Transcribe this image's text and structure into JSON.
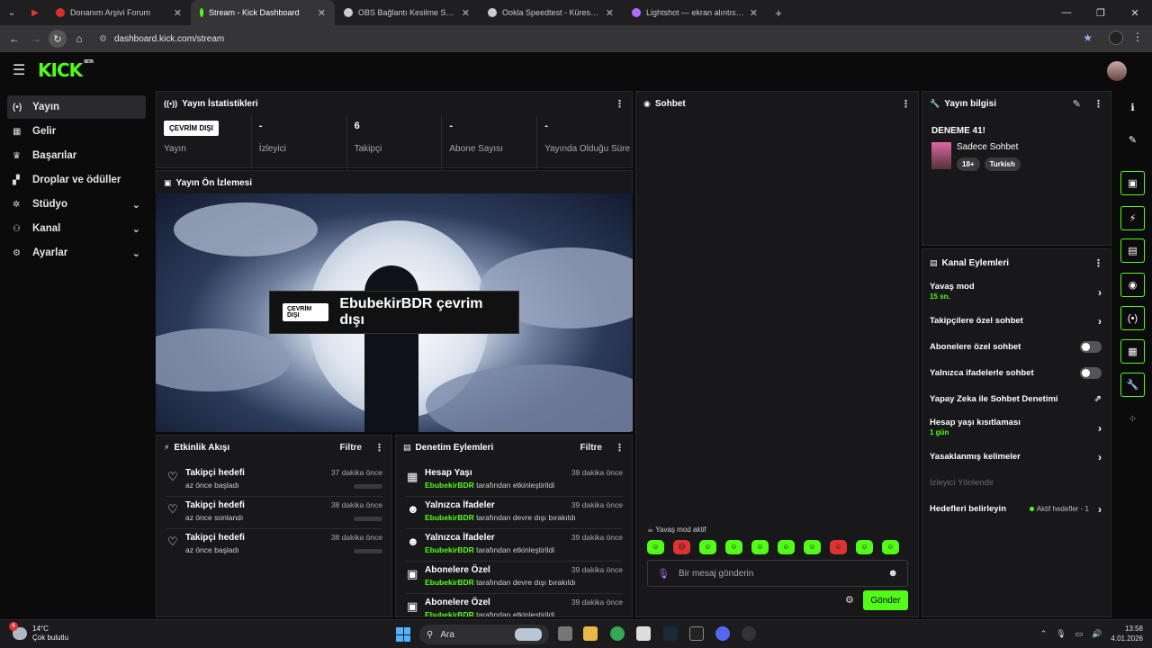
{
  "browser": {
    "tabs": [
      {
        "title": "Donanım Arşivi Forum",
        "color": "#d9302c"
      },
      {
        "title": "Stream - Kick Dashboard",
        "color": "#53fc18"
      },
      {
        "title": "OBS Bağlantı Kesilme Sorunu",
        "color": "#cccccc"
      },
      {
        "title": "Ookla Speedtest - Küresel Geniş",
        "color": "#cccccc"
      },
      {
        "title": "Lightshot — ekran alıntısı aracı",
        "color": "#b06cff"
      }
    ],
    "url": "dashboard.kick.com/stream"
  },
  "app": {
    "logo": "KICK",
    "beta": "BETA"
  },
  "sidebar": {
    "items": [
      {
        "label": "Yayın",
        "icon": "broadcast-icon"
      },
      {
        "label": "Gelir",
        "icon": "revenue-icon"
      },
      {
        "label": "Başarılar",
        "icon": "trophy-icon"
      },
      {
        "label": "Droplar ve ödüller",
        "icon": "gift-icon"
      },
      {
        "label": "Stüdyo",
        "icon": "studio-icon"
      },
      {
        "label": "Kanal",
        "icon": "channel-icon"
      },
      {
        "label": "Ayarlar",
        "icon": "gear-icon"
      }
    ]
  },
  "stats": {
    "title": "Yayın İstatistikleri",
    "items": [
      {
        "value": "ÇEVRİM DIŞI",
        "label": "Yayın"
      },
      {
        "value": "-",
        "label": "İzleyici"
      },
      {
        "value": "6",
        "label": "Takipçi"
      },
      {
        "value": "-",
        "label": "Abone Sayısı"
      },
      {
        "value": "-",
        "label": "Yayında Olduğu Süre"
      }
    ]
  },
  "preview": {
    "title": "Yayın Ön İzlemesi",
    "badge": "ÇEVRİM DIŞI",
    "message": "EbubekirBDR çevrim dışı"
  },
  "activity": {
    "title": "Etkinlik Akışı",
    "filter": "Filtre",
    "rows": [
      {
        "title": "Takipçi hedefi",
        "sub": "az önce başladı",
        "time": "37 dakika önce"
      },
      {
        "title": "Takipçi hedefi",
        "sub": "az önce sonlandı",
        "time": "38 dakika önce"
      },
      {
        "title": "Takipçi hedefi",
        "sub": "az önce başladı",
        "time": "38 dakika önce"
      }
    ]
  },
  "moderation": {
    "title": "Denetim Eylemleri",
    "filter": "Filtre",
    "rows": [
      {
        "title": "Hesap Yaşı",
        "user": "EbubekirBDR",
        "action": "tarafından etkinleştirildi",
        "time": "39 dakika önce"
      },
      {
        "title": "Yalnızca İfadeler",
        "user": "EbubekirBDR",
        "action": "tarafından devre dışı bırakıldı",
        "time": "39 dakika önce"
      },
      {
        "title": "Yalnızca İfadeler",
        "user": "EbubekirBDR",
        "action": "tarafından etkinleştirildi",
        "time": "39 dakika önce"
      },
      {
        "title": "Abonelere Özel",
        "user": "EbubekirBDR",
        "action": "tarafından devre dışı bırakıldı",
        "time": "39 dakika önce"
      },
      {
        "title": "Abonelere Özel",
        "user": "EbubekirBDR",
        "action": "tarafından etkinleştirildi",
        "time": "39 dakika önce"
      }
    ]
  },
  "chat": {
    "title": "Sohbet",
    "slow_mode_label": "Yavaş mod aktif",
    "placeholder": "Bir mesaj gönderin",
    "send": "Gönder"
  },
  "stream_info": {
    "title": "Yayın bilgisi",
    "stream_title": "DENEME 41!",
    "category": "Sadece Sohbet",
    "tags": [
      "18+",
      "Turkish"
    ]
  },
  "channel_actions": {
    "title": "Kanal Eylemleri",
    "slow_mode": {
      "label": "Yavaş mod",
      "value": "15 sn."
    },
    "followers_only": "Takipçilere özel sohbet",
    "subscribers_only": "Abonelere özel sohbet",
    "emotes_only": "Yalnızca ifadelerle sohbet",
    "ai_moderation": "Yapay Zeka ile Sohbet Denetimi",
    "account_age": {
      "label": "Hesap yaşı kısıtlaması",
      "value": "1 gün"
    },
    "banned_words": "Yasaklanmış kelimeler",
    "viewer_directed": "İzleyici Yönlendir",
    "goals": {
      "label": "Hedefleri belirleyin",
      "value": "Aktif hedefler - 1"
    }
  },
  "taskbar": {
    "temp": "14°C",
    "weather": "Çok bulutlu",
    "weather_badge": "4",
    "search": "Ara",
    "time": "13:58",
    "date": "4.01.2026"
  }
}
